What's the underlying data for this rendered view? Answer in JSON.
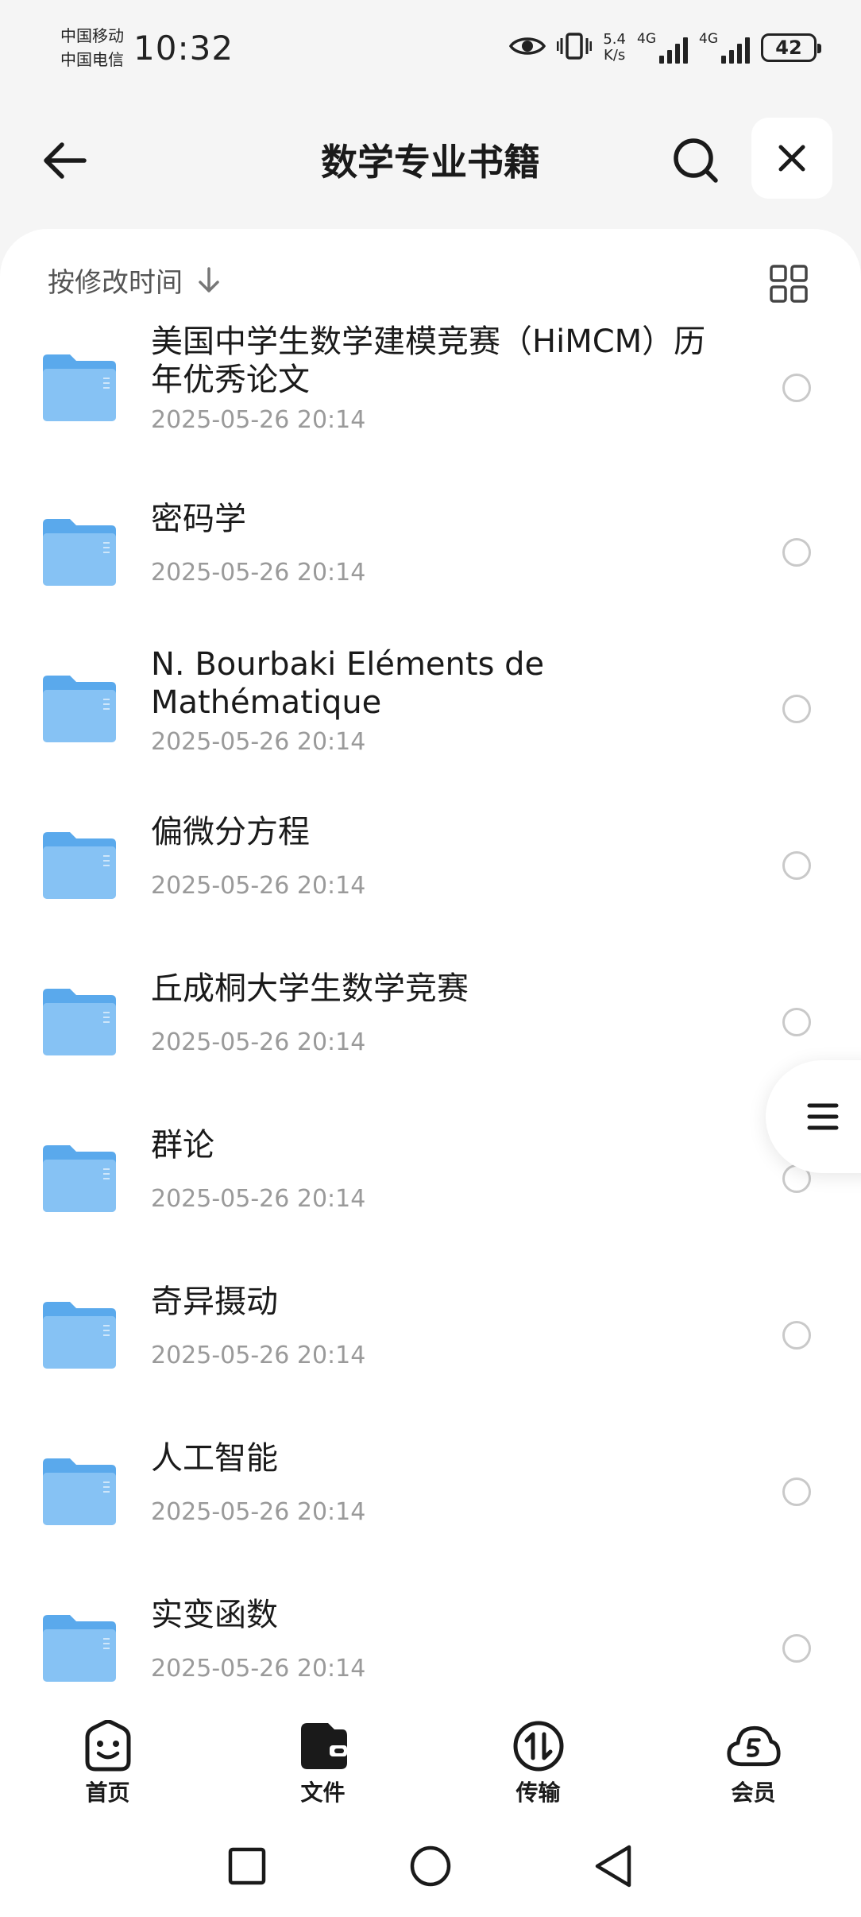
{
  "status_bar": {
    "carrier_1": "中国移动",
    "carrier_2": "中国电信",
    "time": "10:32",
    "speed_value": "5.4",
    "speed_unit": "K/s",
    "net_1": "4G",
    "net_2": "4G",
    "battery": "42"
  },
  "header": {
    "title": "数学专业书籍"
  },
  "sort": {
    "label": "按修改时间"
  },
  "folders": [
    {
      "name": "美国中学生数学建模竞赛（HiMCM）历年优秀论文",
      "date": "2025-05-26 20:14"
    },
    {
      "name": "密码学",
      "date": "2025-05-26 20:14"
    },
    {
      "name": "N. Bourbaki Eléments de Mathématique",
      "date": "2025-05-26 20:14"
    },
    {
      "name": "偏微分方程",
      "date": "2025-05-26 20:14"
    },
    {
      "name": "丘成桐大学生数学竞赛",
      "date": "2025-05-26 20:14"
    },
    {
      "name": "群论",
      "date": "2025-05-26 20:14"
    },
    {
      "name": "奇异摄动",
      "date": "2025-05-26 20:14"
    },
    {
      "name": "人工智能",
      "date": "2025-05-26 20:14"
    },
    {
      "name": "实变函数",
      "date": "2025-05-26 20:14"
    }
  ],
  "tabs": [
    {
      "label": "首页",
      "icon": "smiley-home-icon"
    },
    {
      "label": "文件",
      "icon": "wallet-files-icon"
    },
    {
      "label": "传输",
      "icon": "transfer-icon"
    },
    {
      "label": "会员",
      "icon": "cloud-vip-icon"
    }
  ],
  "colors": {
    "folder_blue": "#5aa9ec",
    "folder_light": "#a9d4fa",
    "page_bg": "#f5f5f5",
    "radio_border": "#c9c9c9"
  }
}
